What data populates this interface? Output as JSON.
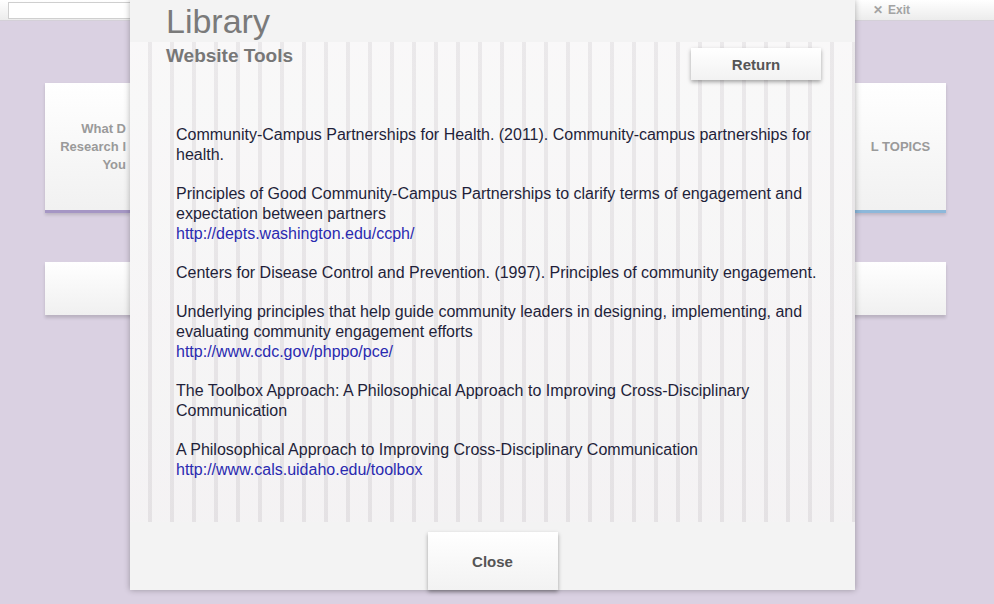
{
  "top_bar": {
    "exit": {
      "icon": "✕",
      "label": "Exit"
    }
  },
  "background_cards": [
    {
      "lines": [
        "What D",
        "Research I",
        "You"
      ],
      "color": "#a596c4"
    },
    {
      "lines": [
        "L TOPICS"
      ],
      "color": "#8db8da"
    }
  ],
  "modal": {
    "title": "Library",
    "subtitle": "Website Tools",
    "return_button": "Return",
    "entries": [
      {
        "text": "Community-Campus Partnerships for Health. (2011). Community-campus partnerships for health.",
        "link": ""
      },
      {
        "text": "Principles of Good Community-Campus Partnerships to clarify terms of engagement and expectation between partners",
        "link": "http://depts.washington.edu/ccph/"
      },
      {
        "text": "Centers for Disease Control and Prevention. (1997). Principles of community engagement.",
        "link": ""
      },
      {
        "text": "Underlying principles that help guide community leaders in designing, implementing, and evaluating community engagement efforts",
        "link": "http://www.cdc.gov/phppo/pce/"
      },
      {
        "text": "The Toolbox Approach: A Philosophical Approach to Improving Cross-Disciplinary Communication",
        "link": ""
      },
      {
        "text": "A Philosophical Approach to Improving Cross-Disciplinary Communication",
        "link": "http://www.cals.uidaho.edu/toolbox"
      }
    ],
    "close_button": "Close"
  }
}
